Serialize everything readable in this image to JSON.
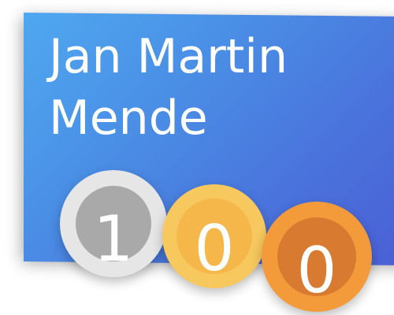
{
  "card": {
    "name_line_1": "Jan Martin",
    "name_line_2": "Mende",
    "colors": {
      "gradient_start": "#4fa8f0",
      "gradient_end": "#4a60d6",
      "text": "#ffffff"
    }
  },
  "coins": [
    {
      "digit": "1",
      "style": "silver",
      "ring_color": "#e6e6e6",
      "face_color": "#a9a9a9"
    },
    {
      "digit": "0",
      "style": "gold",
      "ring_color": "#f7c85e",
      "face_color": "#f5b74a"
    },
    {
      "digit": "0",
      "style": "bronze",
      "ring_color": "#f39a3a",
      "face_color": "#d87a30"
    }
  ]
}
